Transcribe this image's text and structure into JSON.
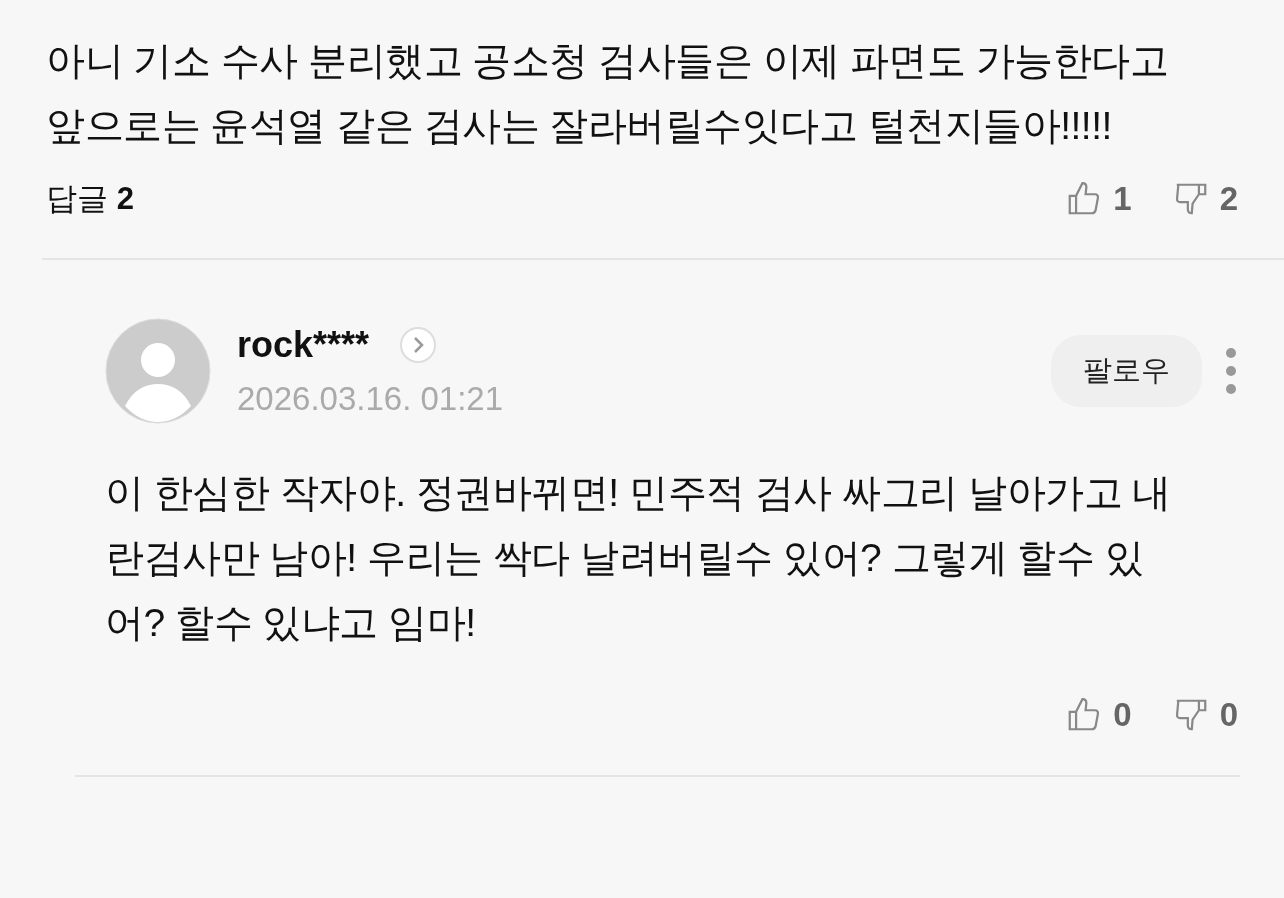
{
  "comment": {
    "text": "아니 기소 수사 분리했고 공소청 검사들은 이제 파면도 가능한다고 앞으로는 윤석열 같은 검사는 잘라버릴수잇다고 털천지들아!!!!!",
    "replies_label": "답글",
    "replies_count": "2",
    "likes": "1",
    "dislikes": "2"
  },
  "reply": {
    "author": "rock****",
    "date": "2026.03.16. 01:21",
    "follow": "팔로우",
    "text": "이 한심한 작자야. 정권바뀌면! 민주적 검사 싸그리 날아가고 내란검사만 남아! 우리는 싹다 날려버릴수 있어? 그렇게 할수 있어? 할수 있냐고 임마!",
    "likes": "0",
    "dislikes": "0"
  }
}
